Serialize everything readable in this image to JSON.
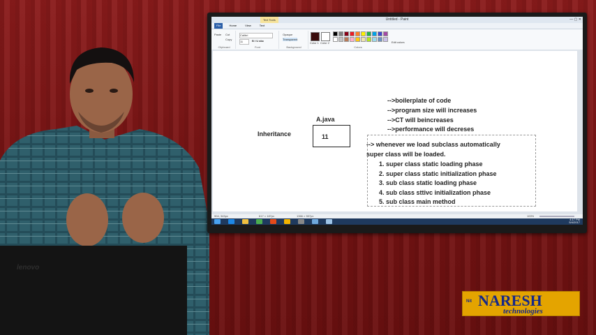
{
  "paint_window": {
    "title": "Untitled - Paint",
    "context_tab": "Text Tools",
    "tabs": [
      "File",
      "Home",
      "View",
      "Text"
    ],
    "clipboard": {
      "paste": "Paste",
      "cut": "Cut",
      "copy": "Copy",
      "label": "Clipboard"
    },
    "font": {
      "name": "Calibri",
      "size": "11",
      "label": "Font"
    },
    "background": {
      "opaque": "Opaque",
      "transparent": "Transparent",
      "label": "Background"
    },
    "colors": {
      "color1": "Color 1",
      "color2": "Color 2",
      "edit": "Edit colors",
      "label": "Colors"
    },
    "status": {
      "pos": "904, 343px",
      "size1": "617 × 187px",
      "size2": "1366 × 557px",
      "zoom": "100%"
    },
    "clock": {
      "time": "4:17 PM",
      "date": "5/4/2017"
    }
  },
  "canvas": {
    "inheritance_label": "Inheritance",
    "file_label": "A.java",
    "box_value": "11",
    "notes": [
      "-->boilerplate of code",
      "-->program size will increases",
      "-->CT will beincreases",
      "-->performance will decreses"
    ],
    "subclass_line1": "--> whenever we load subclass automatically",
    "subclass_line2": "super class will be loaded.",
    "phases": [
      "1. super class static loading phase",
      "2. super class static initialization phase",
      "3. sub class static loading phase",
      "4. sub class sttivc initialization phase",
      "5. sub class main method"
    ]
  },
  "laptop_brand": "lenovo",
  "logo": {
    "tag": "Nit",
    "name": "NARESH",
    "sub": "technologies",
    "color": "#e4a400"
  }
}
